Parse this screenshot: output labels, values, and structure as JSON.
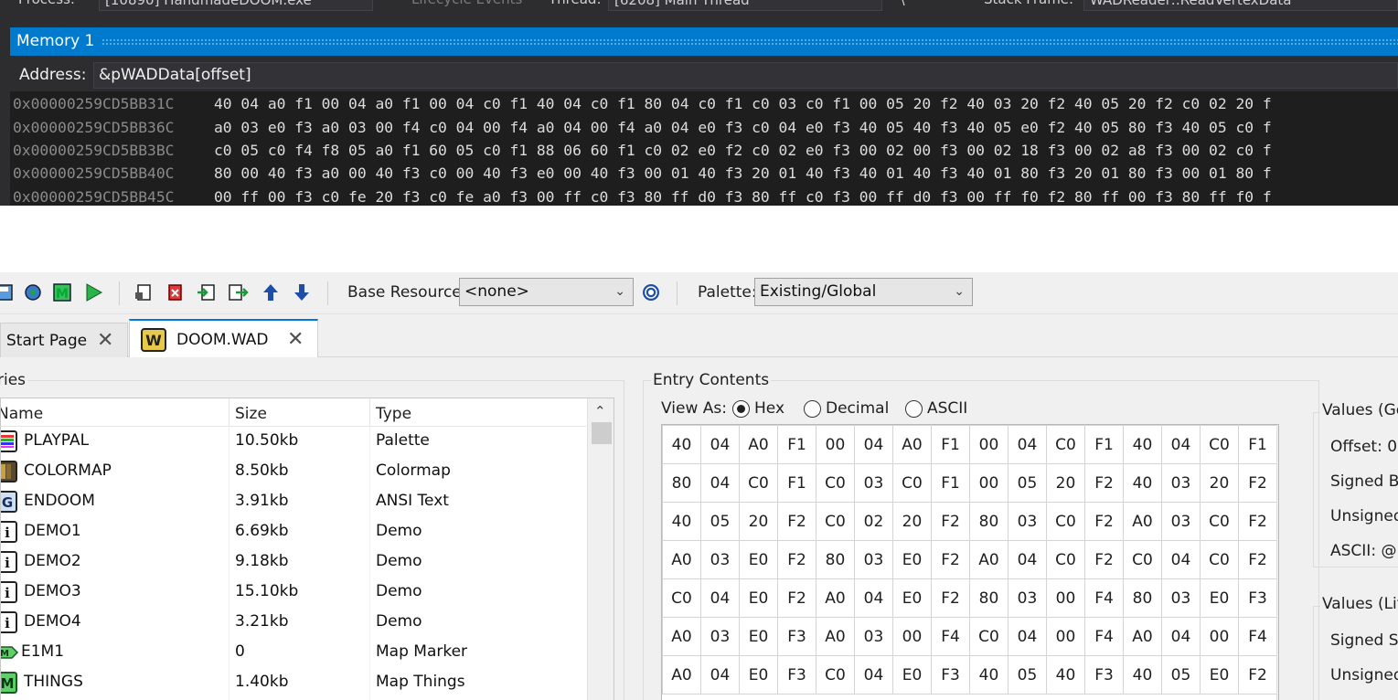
{
  "vs": {
    "debugbar": {
      "process_label": "Process:",
      "process_value": "[10890] HandmadeDOOM.exe",
      "lifecycle_label": "Lifecycle Events",
      "thread_label": "Thread:",
      "thread_value": "[6208] Main Thread",
      "stack_label": "Stack Frame:",
      "stack_value": "WADReader::ReadVertexData"
    },
    "memory_title": "Memory 1",
    "address_label": "Address:",
    "address_value": "&pWADData[offset]",
    "rows": [
      {
        "addr": "0x00000259CD5BB31C",
        "bytes": "40 04 a0 f1 00 04 a0 f1 00 04 c0 f1 40 04 c0 f1 80 04 c0 f1 c0 03 c0 f1 00 05 20 f2 40 03 20 f2 40 05 20 f2 c0 02 20 f"
      },
      {
        "addr": "0x00000259CD5BB36C",
        "bytes": "a0 03 e0 f3 a0 03 00 f4 c0 04 00 f4 a0 04 00 f4 a0 04 e0 f3 c0 04 e0 f3 40 05 40 f3 40 05 e0 f2 40 05 80 f3 40 05 c0 f"
      },
      {
        "addr": "0x00000259CD5BB3BC",
        "bytes": "c0 05 c0 f4 f8 05 a0 f1 60 05 c0 f1 88 06 60 f1 c0 02 e0 f2 c0 02 e0 f3 00 02 00 f3 00 02 18 f3 00 02 a8 f3 00 02 c0 f"
      },
      {
        "addr": "0x00000259CD5BB40C",
        "bytes": "80 00 40 f3 a0 00 40 f3 c0 00 40 f3 e0 00 40 f3 00 01 40 f3 20 01 40 f3 40 01 40 f3 40 01 80 f3 20 01 80 f3 00 01 80 f"
      },
      {
        "addr": "0x00000259CD5BB45C",
        "bytes": "00 ff 00 f3 c0 fe 20 f3 c0 fe a0 f3 00 ff c0 f3 80 ff d0 f3 80 ff c0 f3 00 ff d0 f3 00 ff f0 f2 80 ff 00 f3 80 ff f0 f"
      }
    ]
  },
  "slade": {
    "toolbar": {
      "base_resource_label": "Base Resource:",
      "base_resource_value": "<none>",
      "palette_label": "Palette:",
      "palette_value": "Existing/Global"
    },
    "tabs": [
      {
        "label": "Start Page"
      },
      {
        "label": "DOOM.WAD"
      }
    ],
    "entries": {
      "caption": "ries",
      "columns": {
        "name": "Name",
        "size": "Size",
        "type": "Type"
      },
      "rows": [
        {
          "name": "PLAYPAL",
          "size": "10.50kb",
          "type": "Palette",
          "icon": "palette-icon"
        },
        {
          "name": "COLORMAP",
          "size": "8.50kb",
          "type": "Colormap",
          "icon": "colormap-icon"
        },
        {
          "name": "ENDOOM",
          "size": "3.91kb",
          "type": "ANSI Text",
          "icon": "ansi-icon"
        },
        {
          "name": "DEMO1",
          "size": "6.69kb",
          "type": "Demo",
          "icon": "info-icon"
        },
        {
          "name": "DEMO2",
          "size": "9.18kb",
          "type": "Demo",
          "icon": "info-icon"
        },
        {
          "name": "DEMO3",
          "size": "15.10kb",
          "type": "Demo",
          "icon": "info-icon"
        },
        {
          "name": "DEMO4",
          "size": "3.21kb",
          "type": "Demo",
          "icon": "info-icon"
        },
        {
          "name": "E1M1",
          "size": "0",
          "type": "Map Marker",
          "icon": "map-marker-icon"
        },
        {
          "name": "THINGS",
          "size": "1.40kb",
          "type": "Map Things",
          "icon": "map-icon"
        }
      ]
    },
    "contents": {
      "caption": "Entry Contents",
      "view_as_label": "View As:",
      "radio_hex": "Hex",
      "radio_decimal": "Decimal",
      "radio_ascii": "ASCII",
      "selected": "Hex",
      "hex_rows": [
        [
          "40",
          "04",
          "A0",
          "F1",
          "00",
          "04",
          "A0",
          "F1",
          "00",
          "04",
          "C0",
          "F1",
          "40",
          "04",
          "C0",
          "F1"
        ],
        [
          "80",
          "04",
          "C0",
          "F1",
          "C0",
          "03",
          "C0",
          "F1",
          "00",
          "05",
          "20",
          "F2",
          "40",
          "03",
          "20",
          "F2"
        ],
        [
          "40",
          "05",
          "20",
          "F2",
          "C0",
          "02",
          "20",
          "F2",
          "80",
          "03",
          "C0",
          "F2",
          "A0",
          "03",
          "C0",
          "F2"
        ],
        [
          "A0",
          "03",
          "E0",
          "F2",
          "80",
          "03",
          "E0",
          "F2",
          "A0",
          "04",
          "C0",
          "F2",
          "C0",
          "04",
          "C0",
          "F2"
        ],
        [
          "C0",
          "04",
          "E0",
          "F2",
          "A0",
          "04",
          "E0",
          "F2",
          "80",
          "03",
          "00",
          "F4",
          "80",
          "03",
          "E0",
          "F3"
        ],
        [
          "A0",
          "03",
          "E0",
          "F3",
          "A0",
          "03",
          "00",
          "F4",
          "C0",
          "04",
          "00",
          "F4",
          "A0",
          "04",
          "00",
          "F4"
        ],
        [
          "A0",
          "04",
          "E0",
          "F3",
          "C0",
          "04",
          "E0",
          "F3",
          "40",
          "05",
          "40",
          "F3",
          "40",
          "05",
          "E0",
          "F2"
        ]
      ]
    },
    "values_general": {
      "caption": "Values (Ger",
      "offset": "Offset: 0",
      "signed_byte": "Signed By",
      "unsigned": "Unsigned",
      "ascii": "ASCII: @"
    },
    "values_little": {
      "caption": "Values (Litt",
      "signed_short": "Signed Sh",
      "unsigned": "Unsigned"
    }
  }
}
